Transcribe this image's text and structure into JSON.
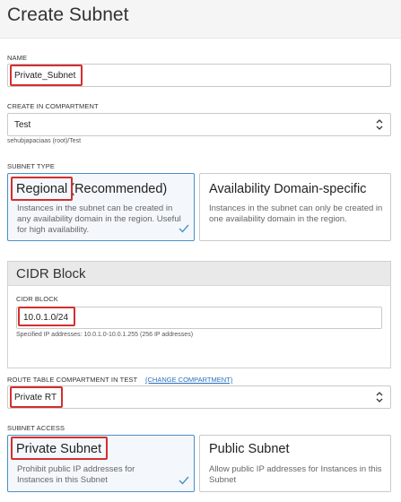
{
  "page": {
    "title": "Create Subnet"
  },
  "name_field": {
    "label": "NAME",
    "value": "Private_Subnet"
  },
  "compartment": {
    "label": "CREATE IN COMPARTMENT",
    "value": "Test",
    "path": "sehubjapaciaas (root)/Test"
  },
  "subnet_type": {
    "label": "SUBNET TYPE",
    "options": [
      {
        "title": "Regional",
        "subtitle": "(Recommended)",
        "description": "Instances in the subnet can be created in any availability domain in the region. Useful for high availability.",
        "selected": true
      },
      {
        "title": "Availability Domain-specific",
        "description": "Instances in the subnet can only be created in one availability domain in the region.",
        "selected": false
      }
    ]
  },
  "cidr": {
    "section_title": "CIDR Block",
    "label": "CIDR BLOCK",
    "value": "10.0.1.0/24",
    "hint": "Specified IP addresses: 10.0.1.0-10.0.1.255 (256 IP addresses)"
  },
  "route_table": {
    "label": "ROUTE TABLE COMPARTMENT IN TEST",
    "change_link": "(CHANGE COMPARTMENT)",
    "value": "Private RT"
  },
  "subnet_access": {
    "label": "SUBNET ACCESS",
    "options": [
      {
        "title": "Private Subnet",
        "description": "Prohibit public IP addresses for Instances in this Subnet",
        "selected": true
      },
      {
        "title": "Public Subnet",
        "description": "Allow public IP addresses for Instances in this Subnet",
        "selected": false
      }
    ]
  },
  "colors": {
    "highlight": "#d32f2f",
    "selected_border": "#4a90c6",
    "link": "#2a6ebb"
  },
  "icons": {
    "select_arrow": "chevron-up-down-icon",
    "check": "checkmark-icon"
  }
}
